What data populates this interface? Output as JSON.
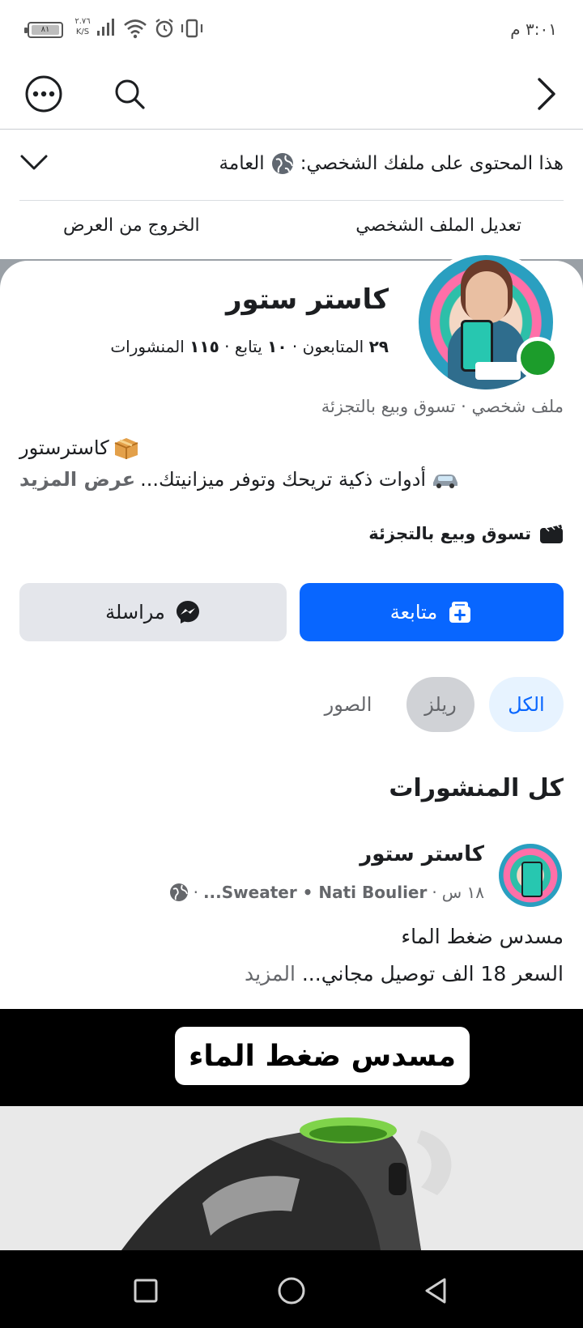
{
  "status_bar": {
    "time": "٣:٠١ م",
    "battery": "٨١",
    "network_speed_value": "٢.٧٦",
    "network_speed_unit": "K/S"
  },
  "top_nav": {
    "icons": [
      "more-icon",
      "search-icon",
      "forward-chevron-icon"
    ]
  },
  "visibility_notice": {
    "text_prefix": "هذا المحتوى على ملفك الشخصي:",
    "audience": "العامة"
  },
  "profile_actions": {
    "edit_profile": "تعديل الملف الشخصي",
    "exit_view": "الخروج من العرض"
  },
  "profile": {
    "name": "كاستر ستور",
    "followers_count": "٢٩",
    "followers_label": "المتابعون",
    "following_count": "١٠",
    "following_label": "يتابع",
    "posts_count": "١١٥",
    "posts_label": "المنشورات",
    "category_line": "ملف شخصي · تسوق وبيع بالتجزئة",
    "bio_line1": "كاسترستور",
    "bio_line2": "أدوات ذكية تريحك وتوفر ميزانيتك...",
    "see_more": "عرض المزيد",
    "category": "تسوق وبيع بالتجزئة"
  },
  "buttons": {
    "follow": "متابعة",
    "message": "مراسلة"
  },
  "tabs": {
    "all": "الكل",
    "reels": "ريلز",
    "photos": "الصور"
  },
  "posts_section": {
    "title": "كل المنشورات"
  },
  "post": {
    "author": "كاستر ستور",
    "time": "١٨ س",
    "tagged": "Sweater • Nati Boulier...",
    "text_line1": "مسدس ضغط الماء",
    "text_line2": "السعر 18 الف توصيل مجاني...",
    "more": "المزيد",
    "media_banner": "مسدس ضغط الماء"
  },
  "colors": {
    "accent": "#0866ff",
    "online": "#1c9c2b",
    "secondary_text": "#65676b"
  }
}
